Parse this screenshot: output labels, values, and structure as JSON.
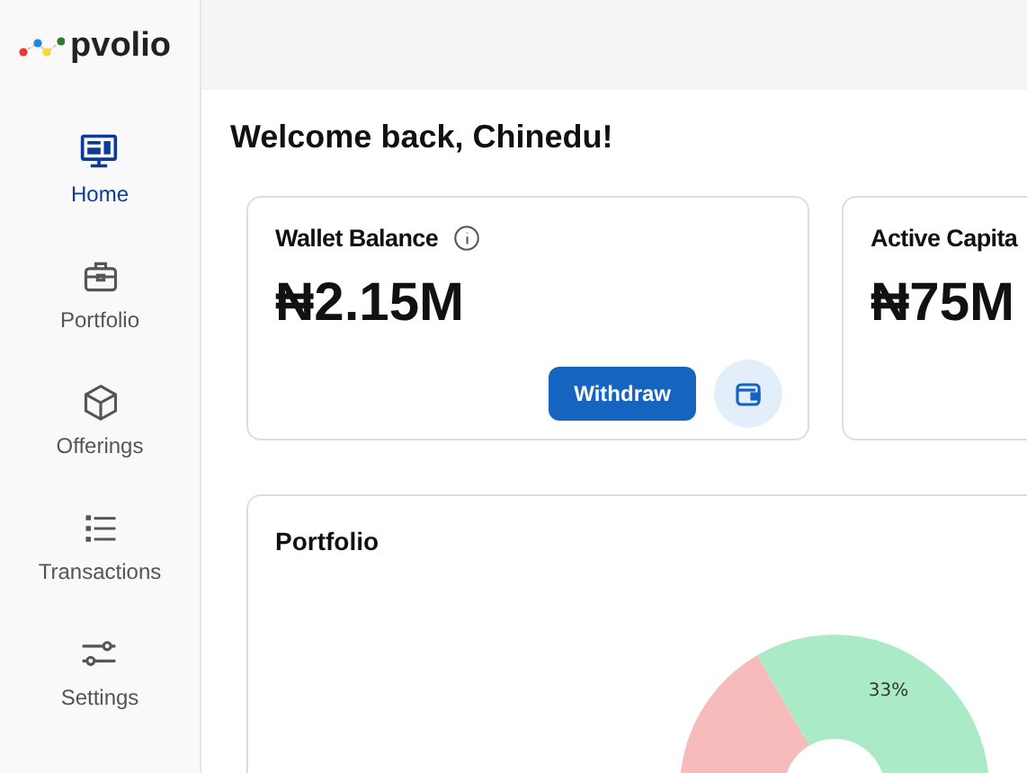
{
  "brand": "pvolio",
  "sidebar": {
    "items": [
      {
        "label": "Home",
        "kind": "monitor",
        "selected": true
      },
      {
        "label": "Portfolio",
        "kind": "briefcase",
        "selected": false
      },
      {
        "label": "Offerings",
        "kind": "box",
        "selected": false
      },
      {
        "label": "Transactions",
        "kind": "list",
        "selected": false
      },
      {
        "label": "Settings",
        "kind": "sliders",
        "selected": false
      }
    ]
  },
  "greeting": "Welcome back, Chinedu!",
  "cards": [
    {
      "title": "Wallet Balance",
      "value": "₦2.15M",
      "kind": "wallet",
      "button": "Withdraw"
    },
    {
      "title": "Active Capita",
      "value": "₦75M",
      "kind": "capital"
    }
  ],
  "portfolio": {
    "title": "Portfolio",
    "slice_label": "33%"
  }
}
